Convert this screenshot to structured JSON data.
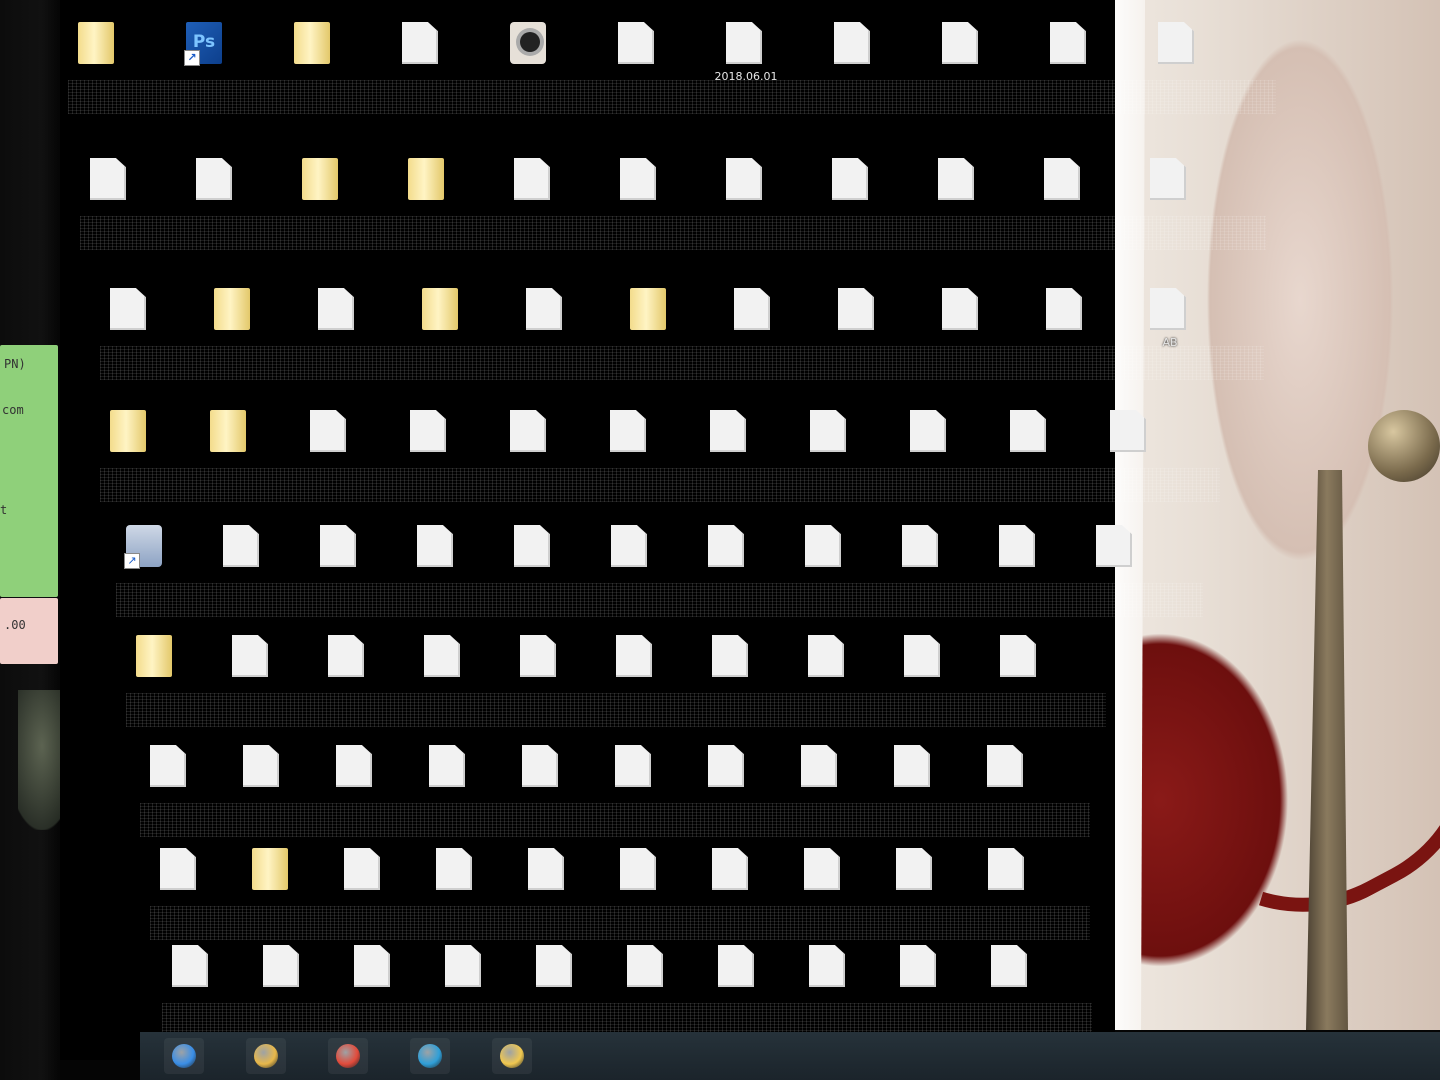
{
  "screen": {
    "type": "desktop",
    "wallpaper": "photo"
  },
  "sticky_notes": {
    "green_lines": [
      "PN)",
      "com",
      "t"
    ],
    "pink_lines": [
      "",
      ".00"
    ]
  },
  "desktop": {
    "rows": [
      {
        "icons": [
          {
            "kind": "folder",
            "label": ""
          },
          {
            "kind": "photoshop-shortcut",
            "label": "",
            "badge": "Ps"
          },
          {
            "kind": "folder",
            "label": ""
          },
          {
            "kind": "file",
            "label": ""
          },
          {
            "kind": "camera-app",
            "label": ""
          },
          {
            "kind": "file",
            "label": ""
          },
          {
            "kind": "file",
            "label": "2018.06.01"
          },
          {
            "kind": "file",
            "label": ""
          },
          {
            "kind": "file",
            "label": ""
          },
          {
            "kind": "file",
            "label": ""
          },
          {
            "kind": "file",
            "label": ""
          }
        ]
      },
      {
        "icons": [
          {
            "kind": "file",
            "label": ""
          },
          {
            "kind": "file",
            "label": ""
          },
          {
            "kind": "folder",
            "label": ""
          },
          {
            "kind": "folder",
            "label": ""
          },
          {
            "kind": "file",
            "label": ""
          },
          {
            "kind": "file",
            "label": ""
          },
          {
            "kind": "file",
            "label": ""
          },
          {
            "kind": "file",
            "label": ""
          },
          {
            "kind": "file",
            "label": ""
          },
          {
            "kind": "file",
            "label": ""
          },
          {
            "kind": "file",
            "label": ""
          }
        ]
      },
      {
        "icons": [
          {
            "kind": "file",
            "label": ""
          },
          {
            "kind": "folder",
            "label": ""
          },
          {
            "kind": "file",
            "label": ""
          },
          {
            "kind": "folder",
            "label": ""
          },
          {
            "kind": "file",
            "label": ""
          },
          {
            "kind": "folder",
            "label": ""
          },
          {
            "kind": "file",
            "label": ""
          },
          {
            "kind": "file",
            "label": ""
          },
          {
            "kind": "file",
            "label": ""
          },
          {
            "kind": "file",
            "label": ""
          },
          {
            "kind": "file",
            "label": "AB"
          }
        ]
      },
      {
        "icons": [
          {
            "kind": "folder",
            "label": ""
          },
          {
            "kind": "folder",
            "label": ""
          },
          {
            "kind": "file",
            "label": ""
          },
          {
            "kind": "file",
            "label": ""
          },
          {
            "kind": "file",
            "label": ""
          },
          {
            "kind": "file",
            "label": ""
          },
          {
            "kind": "file",
            "label": ""
          },
          {
            "kind": "file",
            "label": ""
          },
          {
            "kind": "file",
            "label": ""
          },
          {
            "kind": "file",
            "label": ""
          },
          {
            "kind": "file",
            "label": ""
          }
        ]
      },
      {
        "icons": [
          {
            "kind": "printer-shortcut",
            "label": ""
          },
          {
            "kind": "file",
            "label": ""
          },
          {
            "kind": "file",
            "label": ""
          },
          {
            "kind": "file",
            "label": ""
          },
          {
            "kind": "file",
            "label": ""
          },
          {
            "kind": "file",
            "label": ""
          },
          {
            "kind": "file",
            "label": ""
          },
          {
            "kind": "file",
            "label": ""
          },
          {
            "kind": "file",
            "label": ""
          },
          {
            "kind": "file",
            "label": ""
          },
          {
            "kind": "file",
            "label": ""
          }
        ]
      },
      {
        "icons": [
          {
            "kind": "folder",
            "label": ""
          },
          {
            "kind": "file",
            "label": ""
          },
          {
            "kind": "file",
            "label": ""
          },
          {
            "kind": "file",
            "label": ""
          },
          {
            "kind": "file",
            "label": ""
          },
          {
            "kind": "file",
            "label": ""
          },
          {
            "kind": "file",
            "label": ""
          },
          {
            "kind": "file",
            "label": ""
          },
          {
            "kind": "file",
            "label": ""
          },
          {
            "kind": "file",
            "label": ""
          }
        ]
      },
      {
        "icons": [
          {
            "kind": "file",
            "label": ""
          },
          {
            "kind": "file",
            "label": ""
          },
          {
            "kind": "file",
            "label": ""
          },
          {
            "kind": "file",
            "label": ""
          },
          {
            "kind": "file",
            "label": ""
          },
          {
            "kind": "file",
            "label": ""
          },
          {
            "kind": "file",
            "label": ""
          },
          {
            "kind": "file",
            "label": ""
          },
          {
            "kind": "file",
            "label": ""
          },
          {
            "kind": "file",
            "label": ""
          }
        ]
      },
      {
        "icons": [
          {
            "kind": "file",
            "label": ""
          },
          {
            "kind": "folder",
            "label": ""
          },
          {
            "kind": "file",
            "label": ""
          },
          {
            "kind": "file",
            "label": ""
          },
          {
            "kind": "file",
            "label": ""
          },
          {
            "kind": "file",
            "label": ""
          },
          {
            "kind": "file",
            "label": ""
          },
          {
            "kind": "file",
            "label": ""
          },
          {
            "kind": "file",
            "label": ""
          },
          {
            "kind": "file",
            "label": ""
          }
        ]
      },
      {
        "icons": [
          {
            "kind": "file",
            "label": ""
          },
          {
            "kind": "file",
            "label": ""
          },
          {
            "kind": "file",
            "label": ""
          },
          {
            "kind": "file",
            "label": ""
          },
          {
            "kind": "file",
            "label": ""
          },
          {
            "kind": "file",
            "label": ""
          },
          {
            "kind": "file",
            "label": ""
          },
          {
            "kind": "file",
            "label": ""
          },
          {
            "kind": "file",
            "label": ""
          },
          {
            "kind": "file",
            "label": ""
          }
        ]
      }
    ]
  },
  "taskbar": {
    "buttons": [
      "start-orb-icon",
      "file-explorer-icon",
      "chrome-icon",
      "browser-icon",
      "folder-icon"
    ]
  }
}
